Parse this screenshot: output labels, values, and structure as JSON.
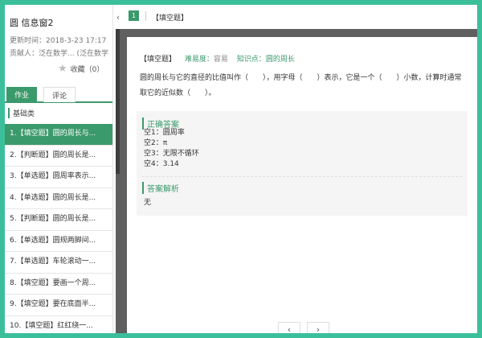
{
  "sidebar": {
    "title": "圆 信息窗2",
    "update_time": "更新时间：2018-3-23 17:17",
    "contributor": "贡献人：泛在数学... (泛在数学",
    "favorite_label": "收藏（0）",
    "tabs": [
      {
        "label": "作业",
        "active": true
      },
      {
        "label": "评论",
        "active": false
      }
    ],
    "section": "基础类",
    "questions": [
      {
        "label": "1.【填空题】圆的周长与...",
        "active": true
      },
      {
        "label": "2.【判断题】圆的周长是...",
        "active": false
      },
      {
        "label": "3.【单选题】圆周率表示...",
        "active": false
      },
      {
        "label": "4.【单选题】圆的周长是...",
        "active": false
      },
      {
        "label": "5.【判断题】圆的周长是...",
        "active": false
      },
      {
        "label": "6.【单选题】圆规两脚间...",
        "active": false
      },
      {
        "label": "7.【单选题】车轮滚动一...",
        "active": false
      },
      {
        "label": "8.【填空题】要画一个周...",
        "active": false
      },
      {
        "label": "9.【填空题】要在底面半...",
        "active": false
      },
      {
        "label": "10.【填空题】红红绕一...",
        "active": false
      }
    ]
  },
  "topbar": {
    "question_number": "1",
    "question_type": "【填空题】"
  },
  "question": {
    "type": "【填空题】",
    "difficulty_label": "难易度：",
    "difficulty": "容易",
    "knowledge_label": "知识点：",
    "knowledge": "圆的周长",
    "text": "圆的周长与它的直径的比值叫作（　　），用字母（　　）表示，它是一个（　　）小数，计算时通常取它的近似数（　　）。"
  },
  "answer": {
    "title": "正确答案",
    "items": [
      "空1：圆周率",
      "空2：π",
      "空3：无限不循环",
      "空4：3.14"
    ]
  },
  "analysis": {
    "title": "答案解析",
    "text": "无"
  },
  "nav": {
    "prev": "‹",
    "next": "›"
  },
  "colors": {
    "accent": "#3b9a6b",
    "background": "#3bbf9a",
    "content_bg": "#5f5f5f"
  }
}
